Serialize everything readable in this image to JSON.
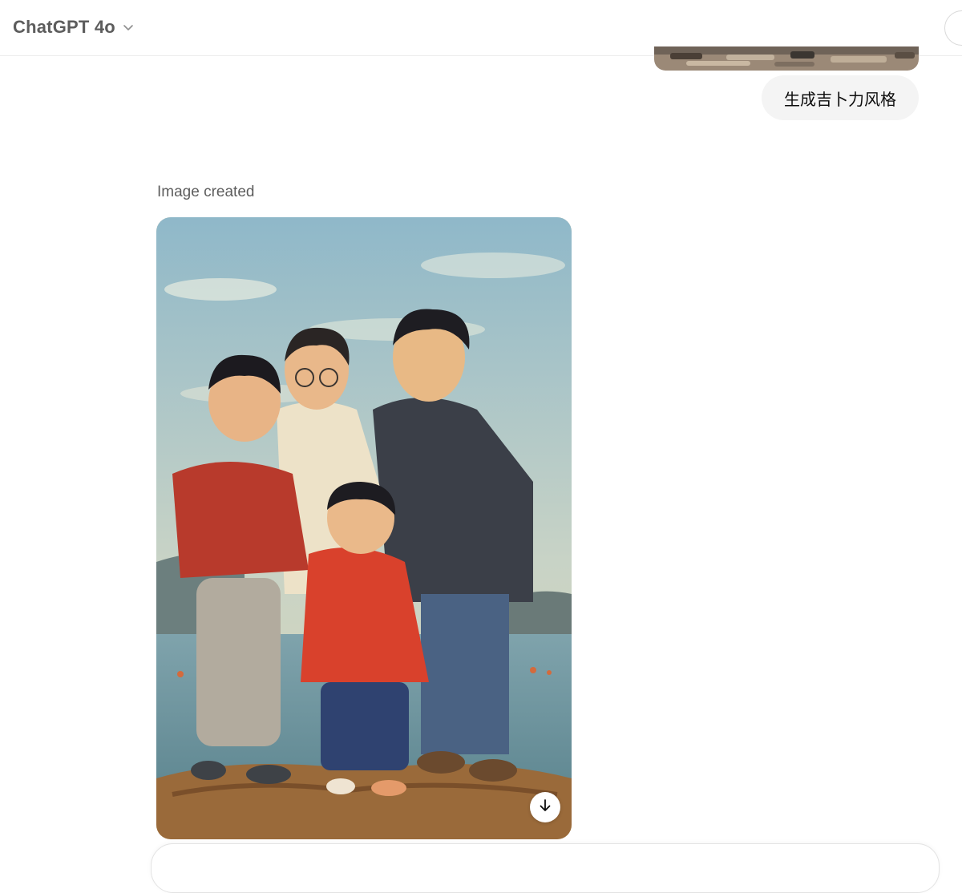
{
  "header": {
    "model_name": "ChatGPT 4o",
    "model_chevron_icon": "chevron-down-icon"
  },
  "conversation": {
    "user_message": "生成吉卜力风格",
    "assistant_status": "Image created",
    "download_icon": "arrow-down-icon"
  },
  "colors": {
    "header_text": "#5d5d5d",
    "user_bubble_bg": "#f4f4f4",
    "divider": "#ececec"
  }
}
